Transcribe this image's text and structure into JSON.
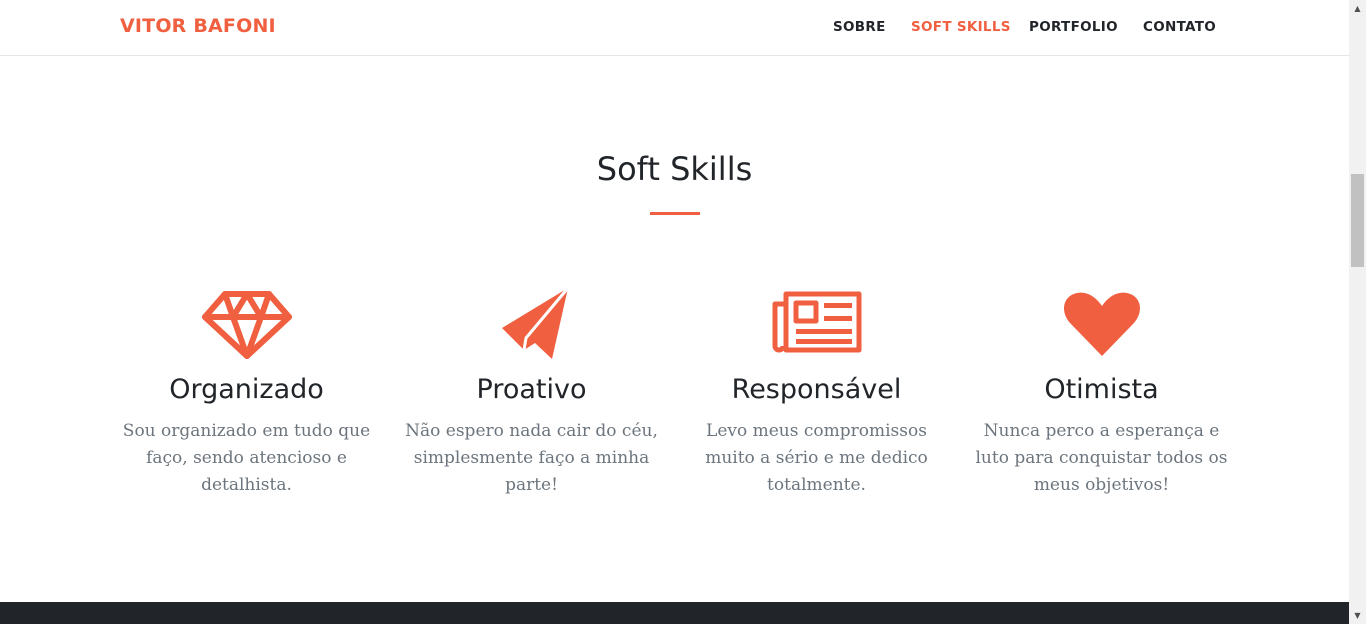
{
  "nav": {
    "brand": "VITOR BAFONI",
    "items": [
      {
        "label": "SOBRE",
        "active": false
      },
      {
        "label": "SOFT SKILLS",
        "active": true
      },
      {
        "label": "PORTFOLIO",
        "active": false
      },
      {
        "label": "CONTATO",
        "active": false
      }
    ]
  },
  "section": {
    "title": "Soft Skills"
  },
  "skills": [
    {
      "icon": "diamond-icon",
      "title": "Organizado",
      "text": "Sou organizado em tudo que faço, sendo atencioso e detalhista."
    },
    {
      "icon": "paper-plane-icon",
      "title": "Proativo",
      "text": "Não espero nada cair do céu, simplesmente faço a minha parte!"
    },
    {
      "icon": "newspaper-icon",
      "title": "Responsável",
      "text": "Levo meus compromissos muito a sério e me dedico totalmente."
    },
    {
      "icon": "heart-icon",
      "title": "Otimista",
      "text": "Nunca perco a esperança e luto para conquistar todos os meus objetivos!"
    }
  ],
  "colors": {
    "accent": "#f05f40",
    "text": "#212529",
    "muted": "#6c757d",
    "footer": "#212529"
  },
  "scrollbar": {
    "up_icon": "scroll-up-arrow-icon",
    "down_icon": "scroll-down-arrow-icon"
  }
}
